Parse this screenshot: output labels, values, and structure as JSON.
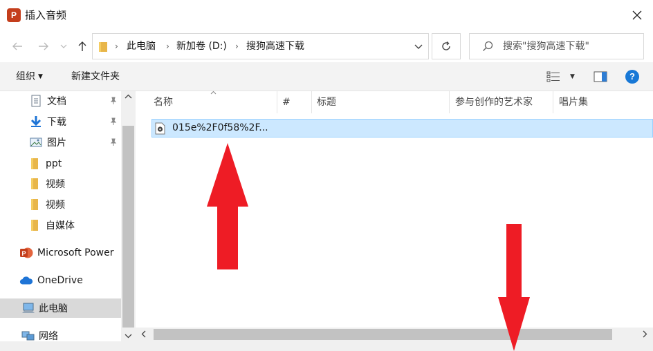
{
  "window": {
    "title": "插入音频",
    "app_icon_letter": "P",
    "close_glyph": "✕"
  },
  "nav_buttons": {
    "back": "←",
    "forward": "→",
    "recent": "⌄",
    "up": "↑"
  },
  "address": {
    "crumbs": [
      "此电脑",
      "新加卷 (D:)",
      "搜狗高速下载"
    ],
    "separator": "›"
  },
  "search": {
    "placeholder": "搜索\"搜狗高速下载\""
  },
  "toolbar": {
    "organize_label": "组织",
    "new_folder_label": "新建文件夹",
    "help_label": "?"
  },
  "navpane": {
    "items": [
      {
        "label": "文档",
        "icon": "document-icon",
        "pinned": true
      },
      {
        "label": "下载",
        "icon": "download-icon",
        "pinned": true
      },
      {
        "label": "图片",
        "icon": "pictures-icon",
        "pinned": true
      },
      {
        "label": "ppt",
        "icon": "folder-icon",
        "pinned": false
      },
      {
        "label": "视频",
        "icon": "folder-icon",
        "pinned": false
      },
      {
        "label": "视频",
        "icon": "folder-icon",
        "pinned": false
      },
      {
        "label": "自媒体",
        "icon": "folder-icon",
        "pinned": false
      },
      {
        "label": "Microsoft Power",
        "icon": "powerpoint-icon",
        "pinned": false
      },
      {
        "label": "OneDrive",
        "icon": "onedrive-icon",
        "pinned": false
      },
      {
        "label": "此电脑",
        "icon": "computer-icon",
        "pinned": false,
        "selected": true
      },
      {
        "label": "网络",
        "icon": "network-icon",
        "pinned": false
      }
    ]
  },
  "columns": [
    "名称",
    "#",
    "标题",
    "参与创作的艺术家",
    "唱片集"
  ],
  "files": [
    {
      "name": "015e%2F0f58%2F...",
      "icon": "audio-file-icon",
      "selected": true
    }
  ],
  "colors": {
    "selection": "#cce8ff",
    "selection_border": "#99d1ff",
    "annotation_arrow": "#ee1c25",
    "help_blue": "#1878d6"
  }
}
